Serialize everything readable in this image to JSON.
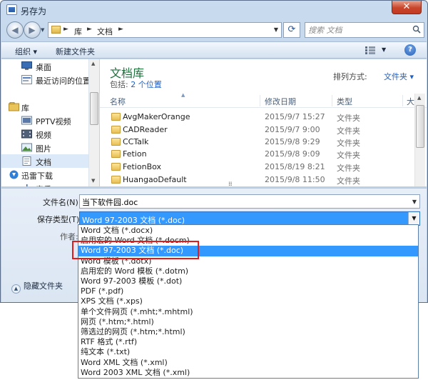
{
  "window": {
    "title": "另存为",
    "close_label": "✕"
  },
  "address": {
    "segments": [
      "库",
      "文档"
    ],
    "search_placeholder": "搜索 文档"
  },
  "toolbar": {
    "organize": "组织 ▾",
    "new_folder": "新建文件夹",
    "help": "?"
  },
  "sidebar": {
    "items": [
      {
        "label": "桌面",
        "icon": "desktop-icon",
        "group": false
      },
      {
        "label": "最近访问的位置",
        "icon": "recent-places-icon",
        "group": false
      },
      {
        "label": "库",
        "icon": "library-icon",
        "group": true
      },
      {
        "label": "PPTV视频",
        "icon": "video-library-icon",
        "group": false
      },
      {
        "label": "视频",
        "icon": "video-icon",
        "group": false
      },
      {
        "label": "图片",
        "icon": "pictures-icon",
        "group": false
      },
      {
        "label": "文档",
        "icon": "documents-icon",
        "group": false,
        "selected": true
      },
      {
        "label": "迅雷下载",
        "icon": "download-icon",
        "group": false
      },
      {
        "label": "音乐",
        "icon": "music-icon",
        "group": false
      }
    ]
  },
  "main": {
    "library_title": "文档库",
    "includes_label": "包括:",
    "includes_link": "2 个位置",
    "arrange_label": "排列方式:",
    "arrange_value": "文件夹 ▾",
    "columns": {
      "name": "名称",
      "date": "修改日期",
      "type": "类型",
      "size": "大"
    },
    "rows": [
      {
        "name": "AvgMakerOrange",
        "date": "2015/9/7 15:27",
        "type": "文件夹"
      },
      {
        "name": "CADReader",
        "date": "2015/9/7 9:00",
        "type": "文件夹"
      },
      {
        "name": "CCTalk",
        "date": "2015/9/8 9:29",
        "type": "文件夹"
      },
      {
        "name": "Fetion",
        "date": "2015/9/8 9:09",
        "type": "文件夹"
      },
      {
        "name": "FetionBox",
        "date": "2015/8/19 8:21",
        "type": "文件夹"
      },
      {
        "name": "HuangaoDefault",
        "date": "2015/9/8 11:50",
        "type": "文件夹"
      }
    ]
  },
  "form": {
    "filename_label": "文件名(N):",
    "filename_value": "当下软件园.doc",
    "filetype_label": "保存类型(T):",
    "filetype_value": "Word 97-2003 文档 (*.doc)",
    "author_label": "作者:",
    "hide_folders": "隐藏文件夹"
  },
  "dropdown": {
    "active_index": 2,
    "options": [
      "Word 文档 (*.docx)",
      "启用宏的 Word 文档 (*.docm)",
      "Word 97-2003 文档 (*.doc)",
      "Word 模板 (*.dotx)",
      "启用宏的 Word 模板 (*.dotm)",
      "Word 97-2003 模板 (*.dot)",
      "PDF (*.pdf)",
      "XPS 文档 (*.xps)",
      "单个文件网页 (*.mht;*.mhtml)",
      "网页 (*.htm;*.html)",
      "筛选过的网页 (*.htm;*.html)",
      "RTF 格式 (*.rtf)",
      "纯文本 (*.txt)",
      "Word XML 文档 (*.xml)",
      "Word 2003 XML 文档 (*.xml)"
    ]
  },
  "colors": {
    "accent": "#3399ff",
    "highlight_border": "#e31b1b",
    "library_title": "#1e6e3c"
  }
}
